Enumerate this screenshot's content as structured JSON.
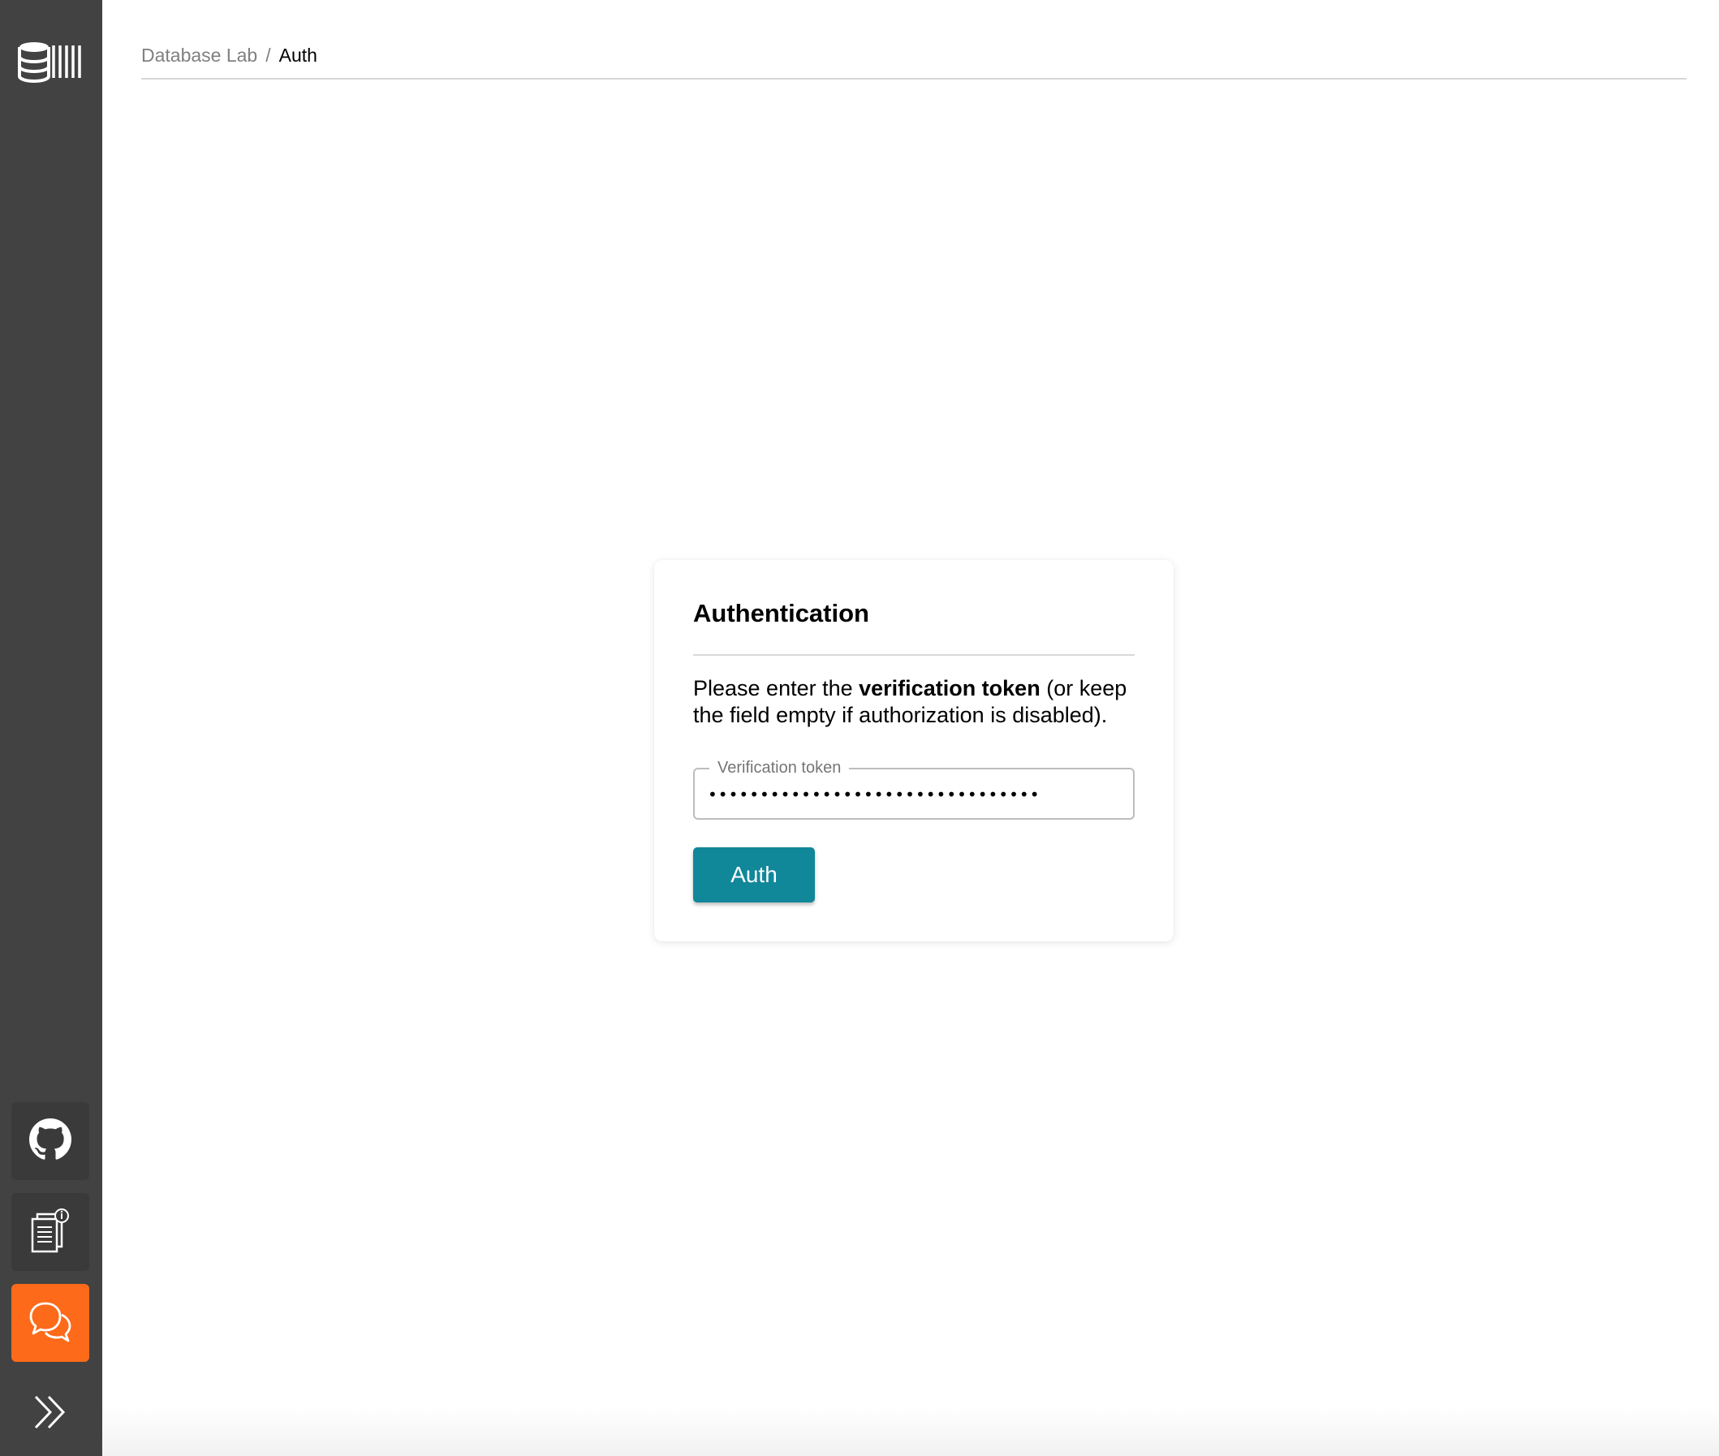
{
  "breadcrumb": {
    "parent": "Database Lab",
    "separator": "/",
    "current": "Auth"
  },
  "sidebar": {
    "logo_icon": "database-lab-logo-icon",
    "buttons": [
      {
        "name": "github",
        "icon": "github-icon"
      },
      {
        "name": "documentation",
        "icon": "docs-icon"
      },
      {
        "name": "support-chat",
        "icon": "chat-icon",
        "color": "#fd6a19"
      }
    ],
    "expand_icon": "double-chevron-right-icon"
  },
  "card": {
    "title": "Authentication",
    "desc_prefix": "Please enter the ",
    "desc_bold": "verification token",
    "desc_suffix": " (or keep the field empty if authorization is disabled).",
    "field_label": "Verification token",
    "field_value": "********************************",
    "button_label": "Auth"
  },
  "colors": {
    "sidebar": "#424242",
    "accent": "#11879a",
    "support": "#fd6a19"
  }
}
